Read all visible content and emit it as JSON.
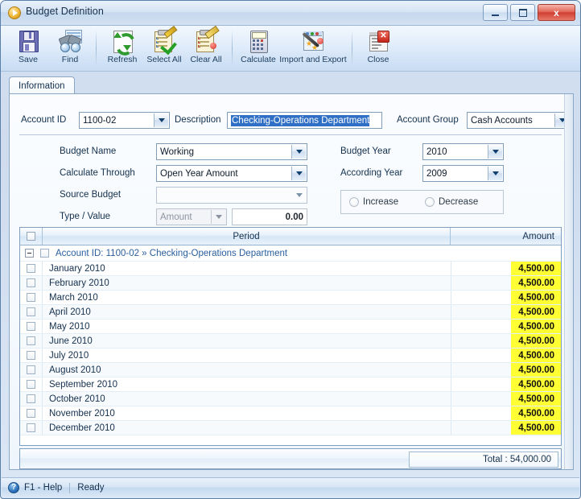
{
  "window": {
    "title": "Budget Definition",
    "title_icon": "play-circle-icon",
    "minimize_label": "Minimize",
    "maximize_label": "Maximize",
    "close_label": "x"
  },
  "toolbar": {
    "buttons": [
      {
        "label": "Save",
        "icon": "floppy-disk-icon"
      },
      {
        "label": "Find",
        "icon": "binoculars-icon"
      },
      {
        "label": "Refresh",
        "icon": "refresh-arrows-icon"
      },
      {
        "label": "Select All",
        "icon": "clipboard-check-icon"
      },
      {
        "label": "Clear All",
        "icon": "clipboard-eraser-icon"
      },
      {
        "label": "Calculate",
        "icon": "calculator-icon"
      },
      {
        "label": "Import and Export",
        "icon": "magic-wand-icon"
      },
      {
        "label": "Close",
        "icon": "document-close-icon"
      }
    ]
  },
  "tabs": [
    {
      "label": "Information",
      "active": true
    }
  ],
  "header_fields": {
    "account_id_label": "Account ID",
    "account_id_value": "1100-02",
    "description_label": "Description",
    "description_value": "Checking-Operations Department",
    "account_group_label": "Account Group",
    "account_group_value": "Cash Accounts"
  },
  "form_left": [
    {
      "label": "Budget Name",
      "value": "Working",
      "type": "combo",
      "disabled": false
    },
    {
      "label": "Calculate Through",
      "value": "Open Year Amount",
      "type": "combo",
      "disabled": false
    },
    {
      "label": "Source Budget",
      "value": "",
      "type": "combo-flat",
      "disabled": true
    },
    {
      "label": "Type / Value",
      "value": "Amount",
      "value2": "0.00",
      "type": "combo-pair",
      "disabled": true
    }
  ],
  "form_right": [
    {
      "label": "Budget Year",
      "value": "2010",
      "type": "combo"
    },
    {
      "label": "According Year",
      "value": "2009",
      "type": "combo"
    }
  ],
  "radios": [
    {
      "label": "Increase",
      "checked": false
    },
    {
      "label": "Decrease",
      "checked": false
    }
  ],
  "grid": {
    "columns": [
      "",
      "Period",
      "Amount"
    ],
    "group_row": {
      "text": "Account ID: 1100-02 » Checking-Operations Department",
      "expanded": true
    },
    "highlight_color": "#ffff33",
    "rows": [
      {
        "period": "January 2010",
        "amount": "4,500.00",
        "checked": false
      },
      {
        "period": "February 2010",
        "amount": "4,500.00",
        "checked": false
      },
      {
        "period": "March 2010",
        "amount": "4,500.00",
        "checked": false
      },
      {
        "period": "April 2010",
        "amount": "4,500.00",
        "checked": false
      },
      {
        "period": "May 2010",
        "amount": "4,500.00",
        "checked": false
      },
      {
        "period": "June 2010",
        "amount": "4,500.00",
        "checked": false
      },
      {
        "period": "July 2010",
        "amount": "4,500.00",
        "checked": false
      },
      {
        "period": "August 2010",
        "amount": "4,500.00",
        "checked": false
      },
      {
        "period": "September 2010",
        "amount": "4,500.00",
        "checked": false
      },
      {
        "period": "October 2010",
        "amount": "4,500.00",
        "checked": false
      },
      {
        "period": "November 2010",
        "amount": "4,500.00",
        "checked": false
      },
      {
        "period": "December 2010",
        "amount": "4,500.00",
        "checked": false
      }
    ],
    "total": "Total : 54,000.00"
  },
  "statusbar": {
    "help": "F1 - Help",
    "status": "Ready",
    "help_icon": "question-mark-icon"
  }
}
